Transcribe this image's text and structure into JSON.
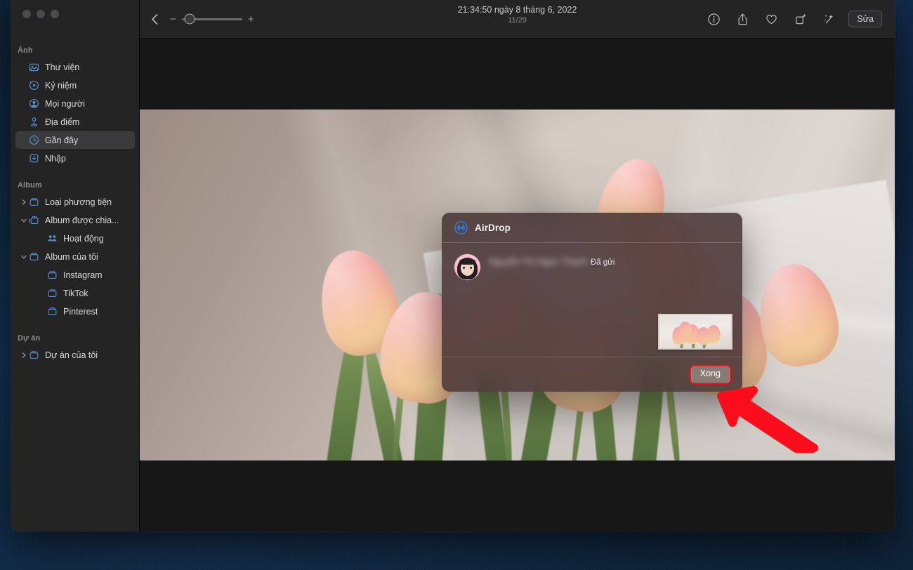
{
  "window": {
    "traffic_lights": [
      "close",
      "minimize",
      "maximize"
    ]
  },
  "sidebar": {
    "sections": [
      {
        "title": "Ảnh",
        "items": [
          {
            "label": "Thư viện",
            "icon": "library-icon",
            "indent": 0,
            "twisty": "",
            "selected": false
          },
          {
            "label": "Kỷ niệm",
            "icon": "memories-icon",
            "indent": 0,
            "twisty": "",
            "selected": false
          },
          {
            "label": "Mọi người",
            "icon": "people-icon",
            "indent": 0,
            "twisty": "",
            "selected": false
          },
          {
            "label": "Địa điểm",
            "icon": "places-icon",
            "indent": 0,
            "twisty": "",
            "selected": false
          },
          {
            "label": "Gần đây",
            "icon": "recents-icon",
            "indent": 0,
            "twisty": "",
            "selected": true
          },
          {
            "label": "Nhập",
            "icon": "import-icon",
            "indent": 0,
            "twisty": "",
            "selected": false
          }
        ]
      },
      {
        "title": "Album",
        "items": [
          {
            "label": "Loại phương tiện",
            "icon": "folder-icon",
            "indent": 0,
            "twisty": "right",
            "selected": false
          },
          {
            "label": "Album được chia...",
            "icon": "shared-folder-icon",
            "indent": 0,
            "twisty": "down",
            "selected": false
          },
          {
            "label": "Hoạt động",
            "icon": "activity-icon",
            "indent": 2,
            "twisty": "",
            "selected": false
          },
          {
            "label": "Album của tôi",
            "icon": "folder-icon",
            "indent": 0,
            "twisty": "down",
            "selected": false
          },
          {
            "label": "Instagram",
            "icon": "folder-icon",
            "indent": 2,
            "twisty": "",
            "selected": false
          },
          {
            "label": "TikTok",
            "icon": "folder-icon",
            "indent": 2,
            "twisty": "",
            "selected": false
          },
          {
            "label": "Pinterest",
            "icon": "folder-icon",
            "indent": 2,
            "twisty": "",
            "selected": false
          }
        ]
      },
      {
        "title": "Dự án",
        "items": [
          {
            "label": "Dự án của tôi",
            "icon": "folder-icon",
            "indent": 0,
            "twisty": "right",
            "selected": false
          }
        ]
      }
    ]
  },
  "toolbar": {
    "back_icon": "chevron-left-icon",
    "zoom_out_label": "−",
    "zoom_in_label": "+",
    "zoom_value": 12,
    "title": "21:34:50 ngày 8 tháng 6, 2022",
    "subtitle": "11/29",
    "right_icons": [
      {
        "name": "info-icon"
      },
      {
        "name": "share-icon"
      },
      {
        "name": "heart-icon"
      },
      {
        "name": "rotate-icon"
      },
      {
        "name": "auto-enhance-icon"
      }
    ],
    "edit_label": "Sửa"
  },
  "airdrop": {
    "icon": "airdrop-icon",
    "title": "AirDrop",
    "contact_name": "Nguyễn Thị Ngọc Thanh",
    "status": "Đã gửi",
    "thumbnail_alt": "tulip-photo-thumbnail",
    "done_label": "Xong"
  },
  "annotation": {
    "arrow": "red-arrow-pointing-to-done-button",
    "highlight_color": "#fc0d1b"
  },
  "photo": {
    "alt": "pink-tulip-bouquet-on-white-fabric"
  }
}
